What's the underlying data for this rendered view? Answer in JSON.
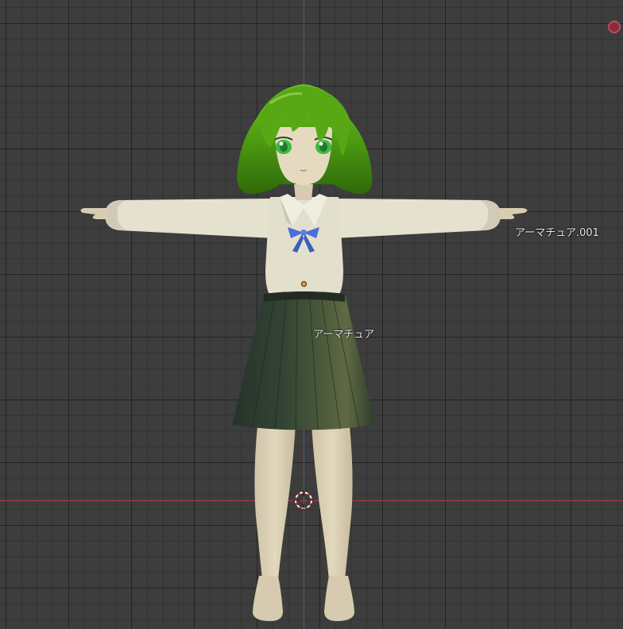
{
  "viewport": {
    "objects": [
      {
        "name": "アーマチュア"
      },
      {
        "name": "アーマチュア.001"
      }
    ]
  },
  "colors": {
    "grid_background": "#3d3d3d",
    "x_axis": "#b03c48",
    "z_axis": "#5d6c8c",
    "hair": "#4a9a12",
    "shirt": "#dedbc4",
    "skirt": "#2d3d2c",
    "ribbon": "#4a6fd6",
    "skin": "#d9cdb1",
    "light": "#c2495c"
  },
  "icons": [
    "light-gizmo-icon",
    "3d-cursor-icon",
    "origin-dot-icon"
  ]
}
